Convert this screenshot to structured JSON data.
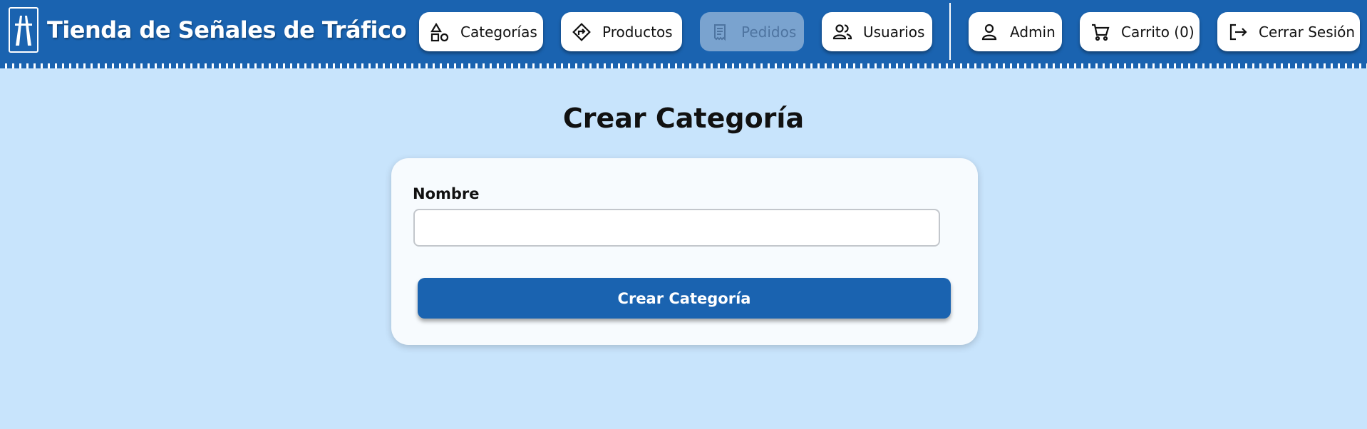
{
  "header": {
    "title": "Tienda de Señales de Tráfico",
    "logo_icon": "motorway-sign-icon",
    "colors": {
      "primary": "#1a63b0",
      "background": "#c8e4fc",
      "disabled": "#7aa3cf"
    }
  },
  "nav": {
    "categories": {
      "label": "Categorías",
      "icon": "shapes-icon"
    },
    "products": {
      "label": "Productos",
      "icon": "road-sign-icon"
    },
    "orders": {
      "label": "Pedidos",
      "icon": "receipt-icon",
      "disabled": true
    },
    "users": {
      "label": "Usuarios",
      "icon": "users-icon"
    },
    "admin": {
      "label": "Admin",
      "icon": "person-icon"
    },
    "cart": {
      "label": "Carrito (0)",
      "icon": "cart-icon"
    },
    "logout": {
      "label": "Cerrar Sesión",
      "icon": "logout-icon"
    }
  },
  "main": {
    "title": "Crear Categoría",
    "form": {
      "name_label": "Nombre",
      "name_value": "",
      "submit_label": "Crear Categoría"
    }
  }
}
